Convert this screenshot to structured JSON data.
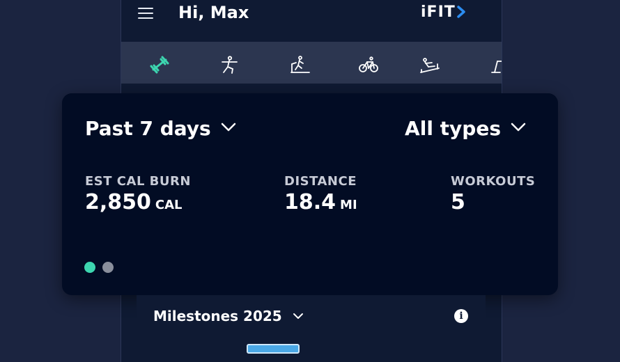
{
  "header": {
    "greeting": "Hi, Max",
    "logo_text": "iFIT"
  },
  "tabs": [
    {
      "icon": "strength-dumbbell-icon",
      "active": true
    },
    {
      "icon": "yoga-icon",
      "active": false
    },
    {
      "icon": "treadmill-icon",
      "active": false
    },
    {
      "icon": "bike-icon",
      "active": false
    },
    {
      "icon": "rower-icon",
      "active": false
    },
    {
      "icon": "incline-trainer-icon",
      "active": false
    }
  ],
  "summary": {
    "range_label": "Past 7 days",
    "type_label": "All types",
    "stats": [
      {
        "label": "EST CAL BURN",
        "value": "2,850",
        "unit": "CAL"
      },
      {
        "label": "DISTANCE",
        "value": "18.4",
        "unit": "MI"
      },
      {
        "label": "WORKOUTS",
        "value": "5",
        "unit": ""
      }
    ],
    "pager": {
      "count": 2,
      "active_index": 0
    }
  },
  "milestones": {
    "title": "Milestones 2025"
  },
  "colors": {
    "accent": "#3dd6b0",
    "card_bg": "#020c24",
    "page_bg": "#1b2440",
    "tabbar_bg": "#2c3650",
    "logo_accent": "#2b8cf0",
    "dot_inactive": "#8a8f9c"
  }
}
